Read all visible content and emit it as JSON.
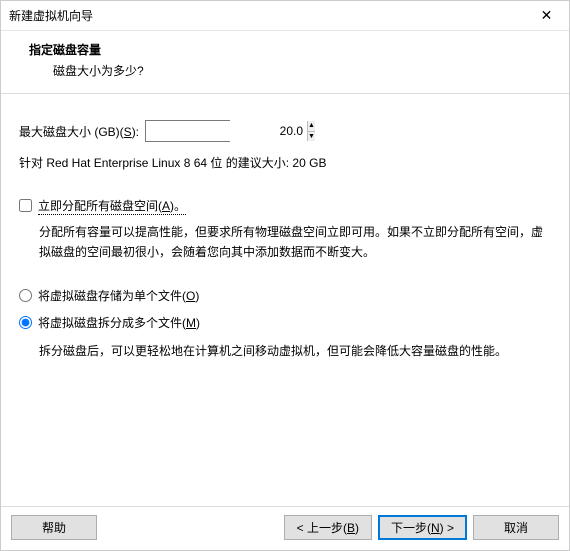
{
  "window": {
    "title": "新建虚拟机向导"
  },
  "header": {
    "heading": "指定磁盘容量",
    "sub": "磁盘大小为多少?"
  },
  "size": {
    "label_pre": "最大磁盘大小 (GB)(",
    "label_u": "S",
    "label_post": "):",
    "value": "20.0"
  },
  "recommend": {
    "text": "针对 Red Hat Enterprise Linux 8 64 位 的建议大小: 20 GB"
  },
  "allocate": {
    "label_pre": "立即分配所有磁盘空间(",
    "label_u": "A",
    "label_post": ")。",
    "desc": "分配所有容量可以提高性能，但要求所有物理磁盘空间立即可用。如果不立即分配所有空间，虚拟磁盘的空间最初很小，会随着您向其中添加数据而不断变大。"
  },
  "radio_single": {
    "label_pre": "将虚拟磁盘存储为单个文件(",
    "label_u": "O",
    "label_post": ")"
  },
  "radio_split": {
    "label_pre": "将虚拟磁盘拆分成多个文件(",
    "label_u": "M",
    "label_post": ")",
    "desc": "拆分磁盘后，可以更轻松地在计算机之间移动虚拟机，但可能会降低大容量磁盘的性能。"
  },
  "footer": {
    "help": "帮助",
    "back_pre": "< 上一步(",
    "back_u": "B",
    "back_post": ")",
    "next_pre": "下一步(",
    "next_u": "N",
    "next_post": ") >",
    "cancel": "取消"
  }
}
